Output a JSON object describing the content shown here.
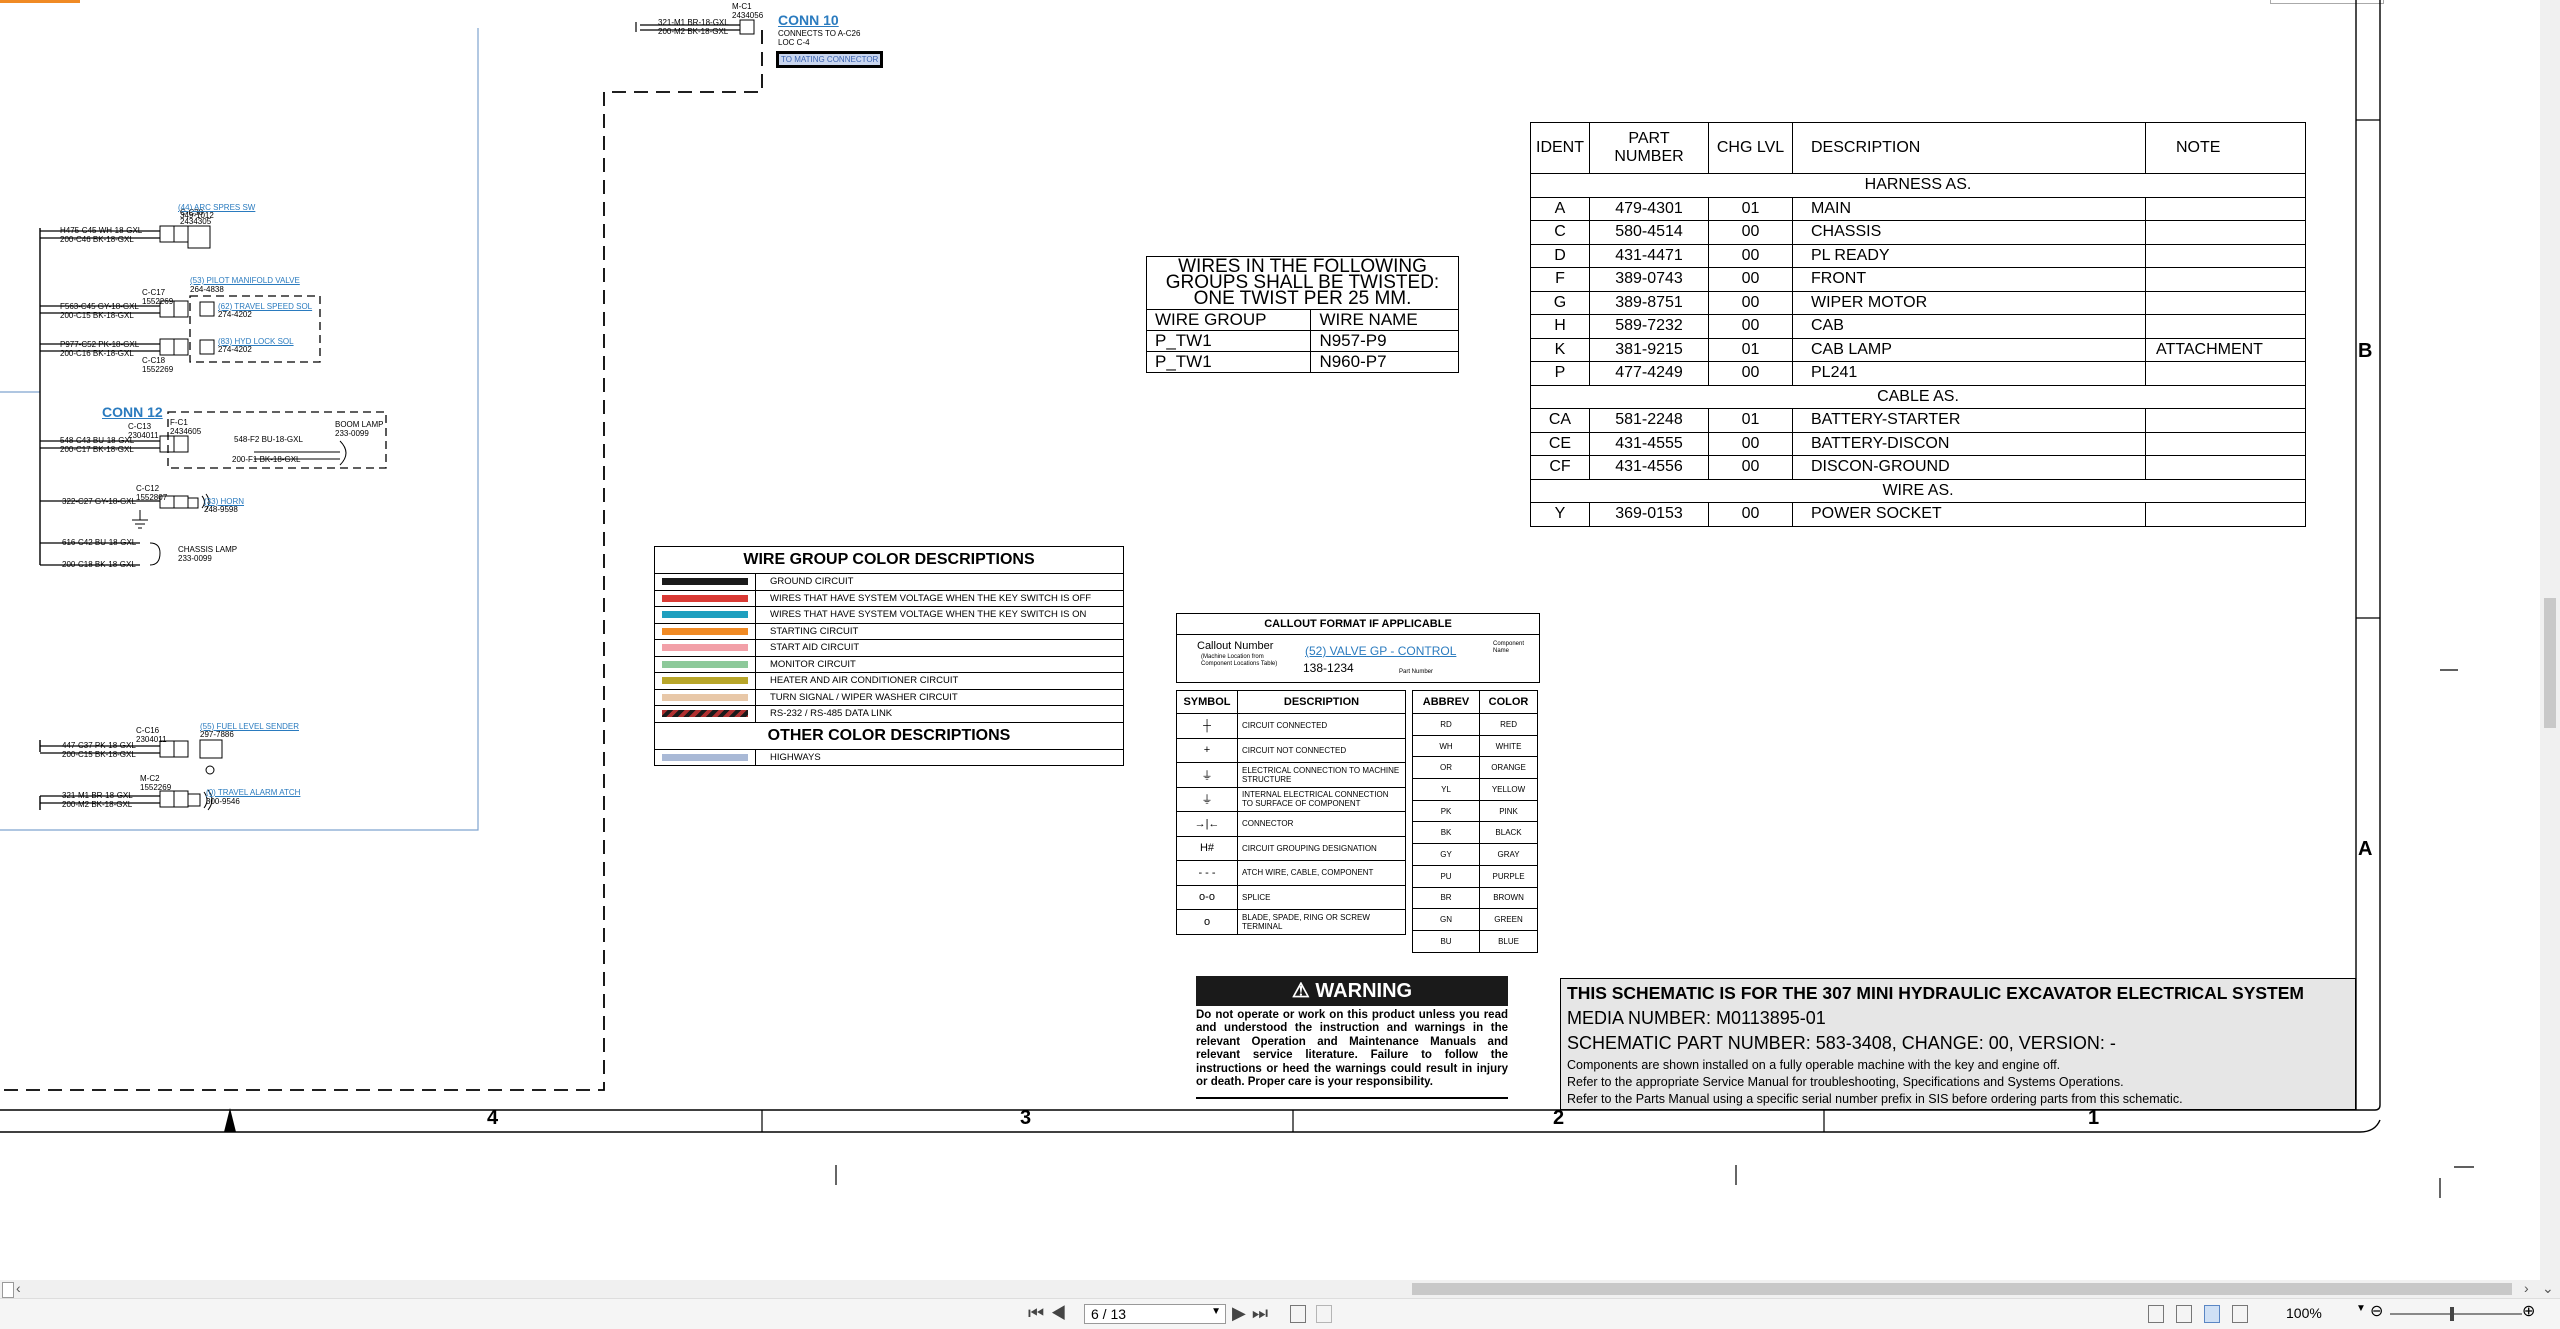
{
  "conn10": {
    "title": "CONN 10",
    "sub1": "CONNECTS TO A-C26",
    "sub2": "LOC C-4",
    "highlight": "TO MATING CONNECTOR",
    "wire1": "321-M1 BR-18-GXL",
    "wire2": "200-M2 BK-18-GXL",
    "tag": "M-C1",
    "tagnum": "2434056"
  },
  "conn12": {
    "title": "CONN 12"
  },
  "left_components": [
    {
      "wire1": "H475-C45 WH-18-GXL",
      "wire2": "200-C46 BK-18-GXL",
      "conn": "C-C38",
      "part": "2434305",
      "label": "(44) ARC SPRES SW",
      "num": "349-1012"
    },
    {
      "conn": "C-C17",
      "part": "1552269",
      "label": "(53) PILOT MANIFOLD VALVE",
      "num": "264-4838"
    },
    {
      "wire1": "F563-C45 GY-18-GXL",
      "wire2": "200-C15 BK-18-GXL",
      "label": "(62) TRAVEL SPEED SOL",
      "num": "274-4202"
    },
    {
      "wire1": "P977-C52 PK-18-GXL",
      "wire2": "200-C16 BK-18-GXL",
      "label": "(83) HYD LOCK SOL",
      "num": "274-4202",
      "conn": "C-C18",
      "part": "1552269"
    },
    {
      "wire1": "548-C43 BU-18-GXL",
      "wire2": "200-C17 BK-18-GXL",
      "conn": "C-C13",
      "part": "2304011",
      "fconn": "F-C1",
      "fpart": "2434605",
      "w3": "548-F2 BU-18-GXL",
      "w4": "200-F1 BK-18-GXL",
      "label": "BOOM LAMP",
      "num": "233-0099"
    },
    {
      "wire1": "322-C27 GY-18-GXL",
      "conn": "C-C12",
      "part": "1552807",
      "label": "(33) HORN",
      "num": "248-9598"
    },
    {
      "wire1": "616-C42 BU-18-GXL",
      "wire2": "200-C18 BK-18-GXL",
      "label": "CHASSIS LAMP",
      "num": "233-0099"
    },
    {
      "wire1": "447-C37 PK-18-GXL",
      "wire2": "200-C15 BK-18-GXL",
      "conn": "C-C16",
      "part": "2304011",
      "label": "(55) FUEL LEVEL SENDER",
      "num": "297-7886"
    },
    {
      "wire1": "321-M1 BR-18-GXL",
      "wire2": "200-M2 BK-18-GXL",
      "conn": "M-C2",
      "part": "1552269",
      "label": "(0) TRAVEL ALARM ATCH",
      "num": "300-9546"
    }
  ],
  "twisted": {
    "header": [
      "WIRES IN THE FOLLOWING",
      "GROUPS SHALL BE TWISTED:",
      "ONE TWIST PER 25 MM."
    ],
    "col1": "WIRE GROUP",
    "col2": "WIRE NAME",
    "rows": [
      [
        "P_TW1",
        "N957-P9"
      ],
      [
        "P_TW1",
        "N960-P7"
      ]
    ]
  },
  "parts_table": {
    "headers": [
      "IDENT",
      "PART NUMBER",
      "CHG LVL",
      "DESCRIPTION",
      "NOTE"
    ],
    "sections": [
      {
        "title": "HARNESS AS.",
        "rows": [
          [
            "A",
            "479-4301",
            "01",
            "MAIN",
            ""
          ],
          [
            "C",
            "580-4514",
            "00",
            "CHASSIS",
            ""
          ],
          [
            "D",
            "431-4471",
            "00",
            "PL READY",
            ""
          ],
          [
            "F",
            "389-0743",
            "00",
            "FRONT",
            ""
          ],
          [
            "G",
            "389-8751",
            "00",
            "WIPER MOTOR",
            ""
          ],
          [
            "H",
            "589-7232",
            "00",
            "CAB",
            ""
          ],
          [
            "K",
            "381-9215",
            "01",
            "CAB LAMP",
            "ATTACHMENT"
          ],
          [
            "P",
            "477-4249",
            "00",
            "PL241",
            ""
          ]
        ]
      },
      {
        "title": "CABLE AS.",
        "rows": [
          [
            "CA",
            "581-2248",
            "01",
            "BATTERY-STARTER",
            ""
          ],
          [
            "CE",
            "431-4555",
            "00",
            "BATTERY-DISCON",
            ""
          ],
          [
            "CF",
            "431-4556",
            "00",
            "DISCON-GROUND",
            ""
          ]
        ]
      },
      {
        "title": "WIRE AS.",
        "rows": [
          [
            "Y",
            "369-0153",
            "00",
            "POWER SOCKET",
            ""
          ]
        ]
      }
    ]
  },
  "wire_groups": {
    "title": "WIRE GROUP COLOR DESCRIPTIONS",
    "items": [
      {
        "label": "GROUND CIRCUIT",
        "color": "#1a1a1a"
      },
      {
        "label": "WIRES THAT HAVE SYSTEM VOLTAGE WHEN THE KEY SWITCH IS OFF",
        "color": "#d93a35"
      },
      {
        "label": "WIRES THAT HAVE SYSTEM VOLTAGE WHEN THE KEY SWITCH IS ON",
        "color": "#1f9fbf"
      },
      {
        "label": "STARTING CIRCUIT",
        "color": "#f08a24"
      },
      {
        "label": "START AID CIRCUIT",
        "color": "#f2a0a8"
      },
      {
        "label": "MONITOR CIRCUIT",
        "color": "#8dc99a"
      },
      {
        "label": "HEATER AND AIR CONDITIONER CIRCUIT",
        "color": "#b8a62a"
      },
      {
        "label": "TURN SIGNAL / WIPER WASHER CIRCUIT",
        "color": "#e8c8a8"
      },
      {
        "label": "RS-232 / RS-485 DATA LINK",
        "color": "#b03030"
      }
    ],
    "other_title": "OTHER COLOR DESCRIPTIONS",
    "other": [
      {
        "label": "HIGHWAYS",
        "color": "#a9b9d6"
      }
    ]
  },
  "callout": {
    "title": "CALLOUT FORMAT IF APPLICABLE",
    "callout_number": "Callout Number",
    "machine_loc": "(Machine Location from",
    "comp_loc": "Component Locations Table)",
    "example": "(52) VALVE GP - CONTROL",
    "component": "Component",
    "name": "Name",
    "part": "138-1234",
    "part_label": "Part Number"
  },
  "symbols": {
    "col1": "SYMBOL",
    "col2": "DESCRIPTION",
    "rows": [
      {
        "glyph": "┼",
        "desc": "CIRCUIT CONNECTED"
      },
      {
        "glyph": "+",
        "desc": "CIRCUIT NOT CONNECTED"
      },
      {
        "glyph": "⏚",
        "desc": "ELECTRICAL CONNECTION TO MACHINE STRUCTURE"
      },
      {
        "glyph": "⏚",
        "desc": "INTERNAL ELECTRICAL CONNECTION TO SURFACE OF COMPONENT"
      },
      {
        "glyph": "→|←",
        "desc": "CONNECTOR"
      },
      {
        "glyph": "H#",
        "desc": "CIRCUIT GROUPING DESIGNATION"
      },
      {
        "glyph": "- - -",
        "desc": "ATCH WIRE, CABLE, COMPONENT"
      },
      {
        "glyph": "o-o",
        "desc": "SPLICE"
      },
      {
        "glyph": "o",
        "desc": "BLADE, SPADE, RING OR SCREW TERMINAL"
      }
    ]
  },
  "abbrev": {
    "col1": "ABBREV",
    "col2": "COLOR",
    "rows": [
      [
        "RD",
        "RED"
      ],
      [
        "WH",
        "WHITE"
      ],
      [
        "OR",
        "ORANGE"
      ],
      [
        "YL",
        "YELLOW"
      ],
      [
        "PK",
        "PINK"
      ],
      [
        "BK",
        "BLACK"
      ],
      [
        "GY",
        "GRAY"
      ],
      [
        "PU",
        "PURPLE"
      ],
      [
        "BR",
        "BROWN"
      ],
      [
        "GN",
        "GREEN"
      ],
      [
        "BU",
        "BLUE"
      ]
    ]
  },
  "warning": {
    "title": "WARNING",
    "text": "Do not operate or work on this product unless you read and understood the instruction and warnings in the relevant Operation and Maintenance Manuals and relevant service literature. Failure to follow the instructions or heed the warnings could result in injury or death. Proper care is your responsibility."
  },
  "titleblock": {
    "line1": "THIS SCHEMATIC IS FOR THE 307 MINI HYDRAULIC EXCAVATOR ELECTRICAL SYSTEM",
    "line2": "MEDIA NUMBER: M0113895-01",
    "line3": "SCHEMATIC PART NUMBER: 583-3408, CHANGE: 00, VERSION: -",
    "line4": "Components are shown installed on a fully operable machine with the key and engine off.",
    "line5": "Refer to the appropriate Service Manual for troubleshooting, Specifications and Systems Operations.",
    "line6": "Refer to the Parts Manual using a specific serial number prefix in SIS before ordering parts from this schematic."
  },
  "zones": {
    "b": "B",
    "a": "A",
    "n4": "4",
    "n3": "3",
    "n2": "2",
    "n1": "1"
  },
  "statusbar": {
    "page": "6 / 13",
    "zoom": "100%"
  }
}
